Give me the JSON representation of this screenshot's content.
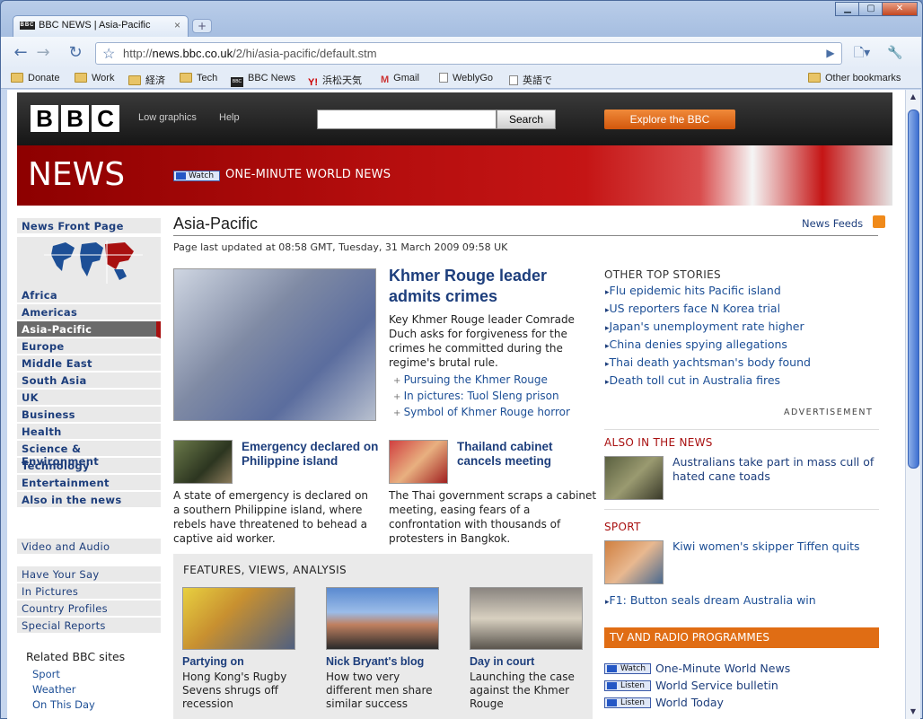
{
  "browser": {
    "tab_title": "BBC NEWS | Asia-Pacific",
    "tab_favicon": "BBC",
    "url_prefix": "http://",
    "url_host": "news.bbc.co.uk",
    "url_path": "/2/hi/asia-pacific/default.stm",
    "bookmarks": [
      "Donate",
      "Work",
      "経済",
      "Tech",
      "BBC News",
      "浜松天気",
      "Gmail",
      "WeblyGo",
      "英語で"
    ],
    "other_bookmarks": "Other bookmarks"
  },
  "masthead": {
    "logo": [
      "B",
      "B",
      "C"
    ],
    "low_graphics": "Low graphics",
    "help": "Help",
    "search_button": "Search",
    "explore": "Explore the BBC"
  },
  "banner": {
    "news": "NEWS",
    "watch": "Watch",
    "watch_label": "ONE-MINUTE WORLD NEWS"
  },
  "leftnav": {
    "front": "News Front Page",
    "items": [
      "Africa",
      "Americas",
      "Asia-Pacific",
      "Europe",
      "Middle East",
      "South Asia",
      "UK",
      "Business",
      "Health",
      "Science & Environment",
      "Technology",
      "Entertainment",
      "Also in the news"
    ],
    "video": "Video and Audio",
    "extra": [
      "Have Your Say",
      "In Pictures",
      "Country Profiles",
      "Special Reports"
    ],
    "related_title": "Related BBC sites",
    "related": [
      "Sport",
      "Weather",
      "On This Day"
    ]
  },
  "main": {
    "title": "Asia-Pacific",
    "feeds": "News Feeds",
    "updated": "Page last updated at 08:58 GMT, Tuesday, 31 March 2009 09:58 UK",
    "lead_title": "Khmer Rouge leader admits crimes",
    "lead_text": "Key Khmer Rouge leader Comrade Duch asks for forgiveness for the crimes he committed during the regime's brutal rule.",
    "lead_links": [
      "Pursuing the Khmer Rouge",
      "In pictures: Tuol Sleng prison",
      "Symbol of Khmer Rouge horror"
    ],
    "story1_title": "Emergency declared on Philippine island",
    "story1_text": "A state of emergency is declared on a southern Philippine island, where rebels have threatened to behead a captive aid worker.",
    "story2_title": "Thailand cabinet cancels meeting",
    "story2_text": "The Thai government scraps a cabinet meeting, easing fears of a confrontation with thousands of protesters in Bangkok.",
    "features_title": "FEATURES, VIEWS, ANALYSIS",
    "features": [
      {
        "title": "Partying on",
        "text": "Hong Kong's Rugby Sevens shrugs off recession"
      },
      {
        "title": "Nick Bryant's blog",
        "text": "How two very different men share similar success"
      },
      {
        "title": "Day in court",
        "text": "Launching the case against the Khmer Rouge"
      }
    ]
  },
  "right": {
    "other_title": "OTHER TOP STORIES",
    "other": [
      "Flu epidemic hits Pacific island",
      "US reporters face N Korea trial",
      "Japan's unemployment rate higher",
      "China denies spying allegations",
      "Thai death yachtsman's body found",
      "Death toll cut in Australia fires"
    ],
    "advert": "ADVERTISEMENT",
    "also_title": "ALSO IN THE NEWS",
    "also_story": "Australians take part in mass cull of hated cane toads",
    "sport_title": "SPORT",
    "sport_story": "Kiwi women's skipper Tiffen quits",
    "sport_link": "F1: Button seals dream Australia win",
    "tv_title": "TV AND RADIO PROGRAMMES",
    "tv": [
      {
        "btn": "Watch",
        "label": "One-Minute World News"
      },
      {
        "btn": "Listen",
        "label": "World Service bulletin"
      },
      {
        "btn": "Listen",
        "label": "World Today"
      }
    ]
  }
}
